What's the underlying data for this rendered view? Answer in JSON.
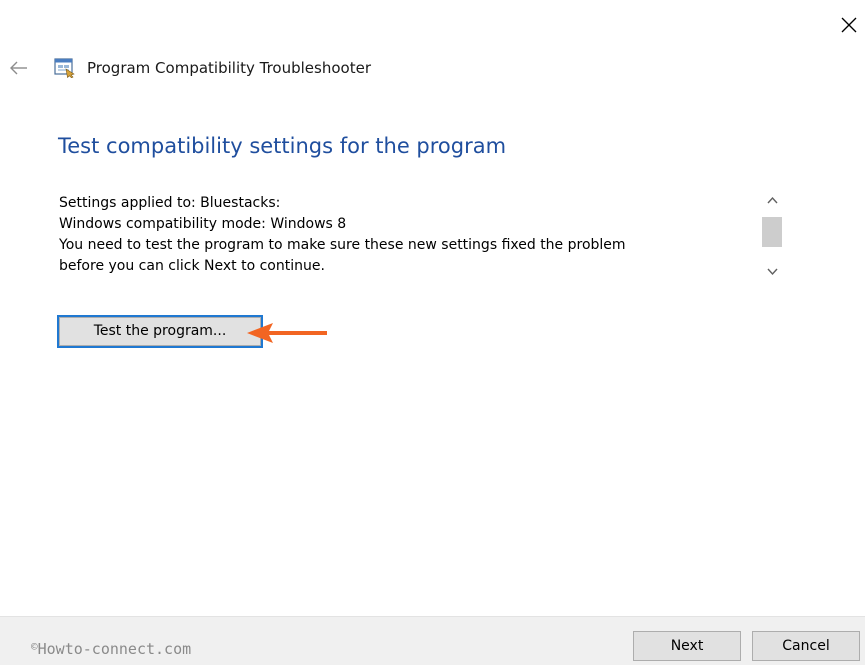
{
  "window": {
    "close_icon": "close-icon",
    "back_icon": "back-arrow-icon"
  },
  "header": {
    "app_icon": "troubleshooter-app-icon",
    "app_title": "Program Compatibility Troubleshooter"
  },
  "main": {
    "page_title": "Test compatibility settings for the program",
    "info_lines": [
      "Settings applied to: Bluestacks:",
      "Windows compatibility mode: Windows 8",
      "You need to test the program to make sure these new settings fixed the problem",
      "before you can click Next to continue."
    ],
    "test_button_label": "Test the program..."
  },
  "annotation": {
    "arrow_color": "#f26522"
  },
  "footer": {
    "watermark_symbol": "©",
    "watermark_text": "Howto-connect.com",
    "next_label": "Next",
    "cancel_label": "Cancel"
  },
  "colors": {
    "title_blue": "#1f4e9e",
    "focus_border": "#1f78d1",
    "button_face": "#e1e1e1",
    "footer_bg": "#f0f0f0"
  }
}
